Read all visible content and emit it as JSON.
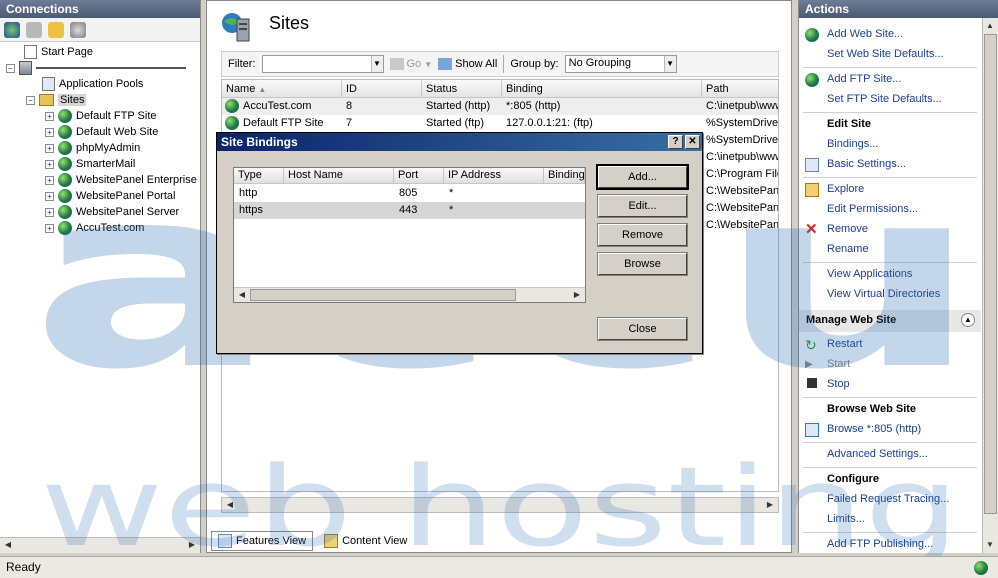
{
  "connections": {
    "title": "Connections",
    "tree": [
      {
        "label": "Start Page",
        "icon": "start-page-icon"
      },
      {
        "label": "",
        "icon": "server-icon"
      },
      {
        "label": "Application Pools",
        "icon": "app-pools-icon"
      },
      {
        "label": "Sites",
        "icon": "sites-folder-icon"
      },
      {
        "label": "Default FTP Site",
        "icon": "globe-icon"
      },
      {
        "label": "Default Web Site",
        "icon": "globe-icon"
      },
      {
        "label": "phpMyAdmin",
        "icon": "globe-icon"
      },
      {
        "label": "SmarterMail",
        "icon": "globe-icon"
      },
      {
        "label": "WebsitePanel Enterprise",
        "icon": "globe-icon"
      },
      {
        "label": "WebsitePanel Portal",
        "icon": "globe-icon"
      },
      {
        "label": "WebsitePanel Server",
        "icon": "globe-icon"
      },
      {
        "label": "AccuTest.com",
        "icon": "globe-icon"
      }
    ]
  },
  "center": {
    "title": "Sites",
    "filter_label": "Filter:",
    "filter_value": "",
    "go_label": "Go",
    "show_all_label": "Show All",
    "group_by_label": "Group by:",
    "group_by_value": "No Grouping",
    "columns": [
      "Name",
      "ID",
      "Status",
      "Binding",
      "Path"
    ],
    "rows": [
      [
        "AccuTest.com",
        "8",
        "Started (http)",
        "*:805 (http)",
        "C:\\inetpub\\www"
      ],
      [
        "Default FTP Site",
        "7",
        "Started (ftp)",
        "127.0.0.1:21: (ftp)",
        "%SystemDrive%"
      ],
      [
        "",
        "",
        "",
        "",
        "%SystemDrive%"
      ],
      [
        "",
        "",
        "",
        "",
        "C:\\inetpub\\www"
      ],
      [
        "",
        "",
        "",
        "",
        "C:\\Program Files"
      ],
      [
        "",
        "",
        "",
        "",
        "C:\\WebsitePanel"
      ],
      [
        "",
        "",
        "",
        "",
        "C:\\WebsitePanel"
      ],
      [
        "",
        "",
        "",
        "",
        "C:\\WebsitePanel"
      ]
    ],
    "tabs": [
      "Features View",
      "Content View"
    ]
  },
  "dialog": {
    "title": "Site Bindings",
    "help_label": "?",
    "close_glyph": "✕",
    "columns": [
      "Type",
      "Host Name",
      "Port",
      "IP Address",
      "Binding"
    ],
    "rows": [
      [
        "http",
        "",
        "805",
        "*",
        ""
      ],
      [
        "https",
        "",
        "443",
        "*",
        ""
      ]
    ],
    "buttons": {
      "add": "Add...",
      "edit": "Edit...",
      "remove": "Remove",
      "browse": "Browse",
      "close": "Close"
    }
  },
  "actions": {
    "title": "Actions",
    "items": {
      "add_web_site": "Add Web Site...",
      "set_web_defaults": "Set Web Site Defaults...",
      "add_ftp_site": "Add FTP Site...",
      "set_ftp_defaults": "Set FTP Site Defaults...",
      "edit_site": "Edit Site",
      "bindings": "Bindings...",
      "basic_settings": "Basic Settings...",
      "explore": "Explore",
      "edit_permissions": "Edit Permissions...",
      "remove": "Remove",
      "rename": "Rename",
      "view_applications": "View Applications",
      "view_virtual_dirs": "View Virtual Directories",
      "manage_web_site": "Manage Web Site",
      "restart": "Restart",
      "start": "Start",
      "stop": "Stop",
      "browse_web_site": "Browse Web Site",
      "browse_805": "Browse *:805 (http)",
      "advanced_settings": "Advanced Settings...",
      "configure": "Configure",
      "failed_request_tracing": "Failed Request Tracing...",
      "limits": "Limits...",
      "add_ftp_publishing": "Add FTP Publishing..."
    }
  },
  "status": {
    "text": "Ready"
  },
  "watermark": {
    "line1": "accu",
    "line2": "web hosting"
  },
  "colors": {
    "link": "#1a3f8f",
    "title_bar": "#0a246a",
    "watermark": "#2a6db5"
  }
}
